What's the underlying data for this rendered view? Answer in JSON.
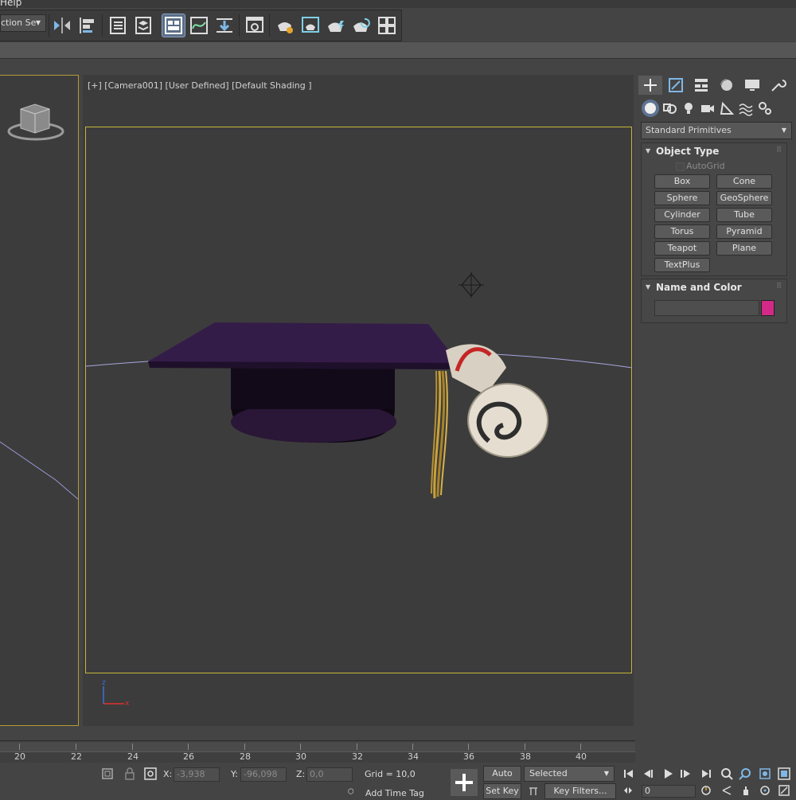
{
  "menu": {
    "visible_item": "Help"
  },
  "toolbar": {
    "selection_set_label": "ction Se",
    "buttons": [
      "mirror-icon",
      "align-icon",
      "scene-explorer-icon",
      "layer-explorer-icon",
      "graphite-toggle-icon",
      "curve-editor-icon",
      "schematic-view-icon",
      "material-editor-icon",
      "render-setup-icon",
      "rendered-frame-icon",
      "render-icon",
      "render-iterative-icon",
      "render-tiles-icon"
    ]
  },
  "viewport": {
    "label": "[+] [Camera001] [User Defined] [Default Shading ]",
    "axis_labels": {
      "x": "x",
      "z": "z"
    }
  },
  "command_panel": {
    "tabs": [
      "create-icon",
      "modify-icon",
      "hierarchy-icon",
      "motion-icon",
      "display-icon",
      "utilities-icon"
    ],
    "subtabs": [
      "geometry-icon",
      "shapes-icon",
      "lights-icon",
      "cameras-icon",
      "helpers-icon",
      "spacewarps-icon",
      "systems-icon"
    ],
    "primitive_dropdown": "Standard Primitives",
    "object_type": {
      "title": "Object Type",
      "autogrid": "AutoGrid",
      "buttons": [
        "Box",
        "Cone",
        "Sphere",
        "GeoSphere",
        "Cylinder",
        "Tube",
        "Torus",
        "Pyramid",
        "Teapot",
        "Plane",
        "TextPlus"
      ]
    },
    "name_and_color": {
      "title": "Name and Color",
      "name_value": "",
      "color": "#d22a86"
    }
  },
  "timeline": {
    "ticks": [
      "20",
      "22",
      "24",
      "26",
      "28",
      "30",
      "32",
      "34",
      "36",
      "38",
      "40"
    ]
  },
  "status": {
    "x_label": "X:",
    "x_value": "-3,938",
    "y_label": "Y:",
    "y_value": "-96,098",
    "z_label": "Z:",
    "z_value": "0,0",
    "grid": "Grid = 10,0",
    "add_time_tag": "Add Time Tag",
    "auto_key": "Auto Key",
    "set_key": "Set Key",
    "selected": "Selected",
    "key_filters": "Key Filters...",
    "frame": "0"
  }
}
